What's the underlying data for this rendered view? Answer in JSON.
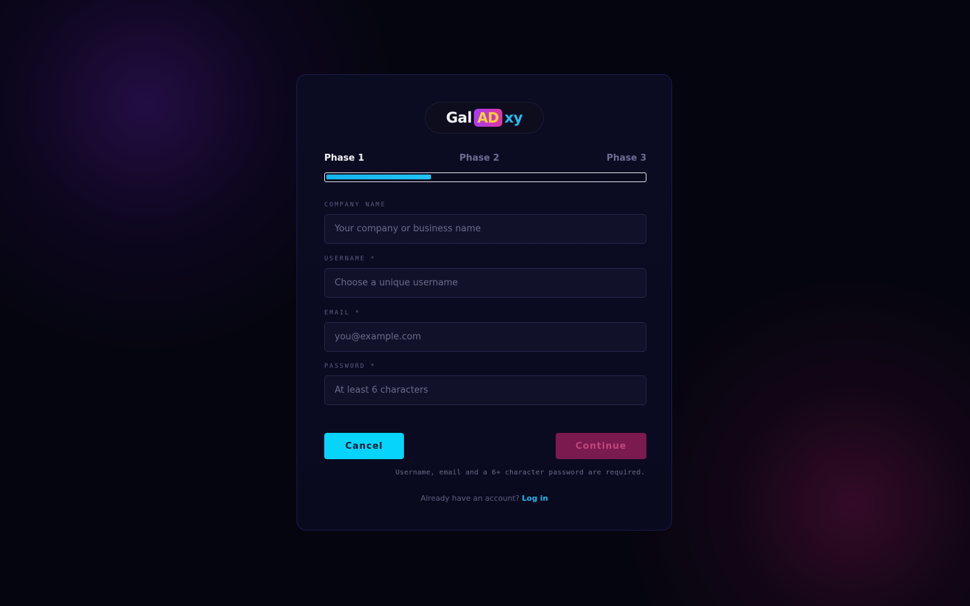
{
  "logo": {
    "part1": "Gal",
    "part2": "AD",
    "part3": "xy"
  },
  "phases": {
    "items": [
      "Phase 1",
      "Phase 2",
      "Phase 3"
    ],
    "active_index": 0,
    "progress_percent": 33
  },
  "form": {
    "company": {
      "label": "COMPANY NAME",
      "placeholder": "Your company or business name",
      "value": ""
    },
    "username": {
      "label": "USERNAME *",
      "placeholder": "Choose a unique username",
      "value": ""
    },
    "email": {
      "label": "EMAIL *",
      "placeholder": "you@example.com",
      "value": ""
    },
    "password": {
      "label": "PASSWORD *",
      "placeholder": "At least 6 characters",
      "value": ""
    }
  },
  "actions": {
    "cancel_label": "Cancel",
    "continue_label": "Continue",
    "hint": "Username, email and a 6+ character password are required."
  },
  "footer": {
    "prompt": "Already have an account?",
    "login_label": "Log in"
  },
  "colors": {
    "accent_cyan": "#07d4fb",
    "continue_bg": "#7a1a4e",
    "progress_fill": "#14b4ee",
    "link": "#1eb8ee"
  }
}
